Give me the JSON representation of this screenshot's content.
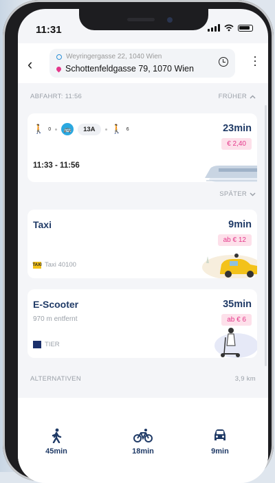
{
  "status": {
    "time": "11:31"
  },
  "route": {
    "from": "Weyringergasse 22, 1040 Wien",
    "to": "Schottenfeldgasse 79, 1070 Wien"
  },
  "departure": {
    "label": "ABFAHRT: 11:56",
    "earlier": "FRÜHER",
    "later": "SPÄTER"
  },
  "transit": {
    "walk_before": "0",
    "line": "13A",
    "walk_after": "6",
    "duration": "23min",
    "price": "€ 2,40",
    "times": "11:33 - 11:56"
  },
  "taxi": {
    "title": "Taxi",
    "duration": "9min",
    "price": "ab € 12",
    "badge": "TAXI",
    "provider": "Taxi 40100"
  },
  "scooter": {
    "title": "E-Scooter",
    "subtitle": "970 m entfernt",
    "duration": "35min",
    "price": "ab € 6",
    "provider": "TIER"
  },
  "alternatives": {
    "label": "ALTERNATIVEN",
    "distance": "3,9 km"
  },
  "modes": [
    {
      "icon": "walk-icon",
      "time": "45min"
    },
    {
      "icon": "bike-icon",
      "time": "18min"
    },
    {
      "icon": "car-icon",
      "time": "9min"
    }
  ],
  "colors": {
    "accent": "#1f3a66",
    "price": "#e4378a",
    "bus": "#2aa8e0"
  }
}
